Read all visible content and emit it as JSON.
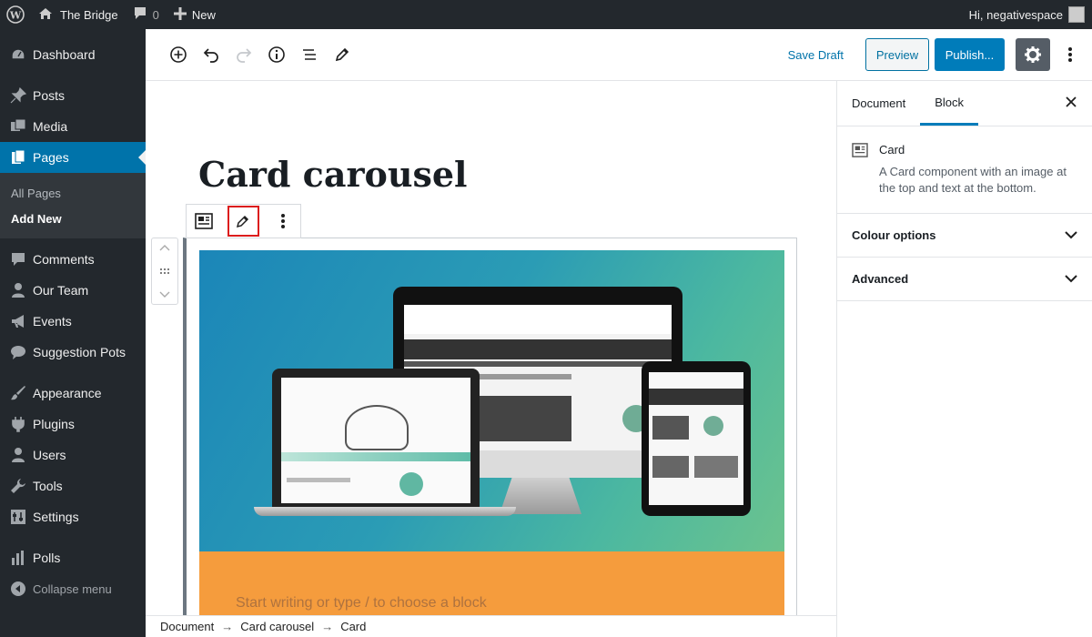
{
  "adminbar": {
    "site_name": "The Bridge",
    "comments_count": "0",
    "new_label": "New",
    "greeting": "Hi, negativespace"
  },
  "sidebar": {
    "items": [
      {
        "label": "Dashboard",
        "icon": "dashboard-icon"
      },
      {
        "label": "Posts",
        "icon": "pin-icon"
      },
      {
        "label": "Media",
        "icon": "media-icon"
      },
      {
        "label": "Pages",
        "icon": "pages-icon",
        "active": true
      },
      {
        "label": "Comments",
        "icon": "comment-icon"
      },
      {
        "label": "Our Team",
        "icon": "user-icon"
      },
      {
        "label": "Events",
        "icon": "megaphone-icon"
      },
      {
        "label": "Suggestion Pots",
        "icon": "comment-icon"
      },
      {
        "label": "Appearance",
        "icon": "brush-icon"
      },
      {
        "label": "Plugins",
        "icon": "plugin-icon"
      },
      {
        "label": "Users",
        "icon": "user-icon"
      },
      {
        "label": "Tools",
        "icon": "wrench-icon"
      },
      {
        "label": "Settings",
        "icon": "settings-icon"
      },
      {
        "label": "Polls",
        "icon": "chart-icon"
      }
    ],
    "submenu": [
      "All Pages",
      "Add New"
    ],
    "collapse_label": "Collapse menu"
  },
  "toolbar": {
    "save_draft": "Save Draft",
    "preview": "Preview",
    "publish": "Publish..."
  },
  "editor": {
    "title": "Card carousel",
    "placeholder": "Start writing or type / to choose a block"
  },
  "settings": {
    "tabs": [
      "Document",
      "Block"
    ],
    "active_tab": "Block",
    "block_name": "Card",
    "block_desc": "A Card component with an image at the top and text at the bottom.",
    "panels": [
      "Colour options",
      "Advanced"
    ]
  },
  "breadcrumb": [
    "Document",
    "Card carousel",
    "Card"
  ],
  "colors": {
    "admin_dark": "#23282d",
    "accent": "#0073aa",
    "card_orange": "#f59c3d",
    "highlight_red": "#dc1d1d"
  }
}
